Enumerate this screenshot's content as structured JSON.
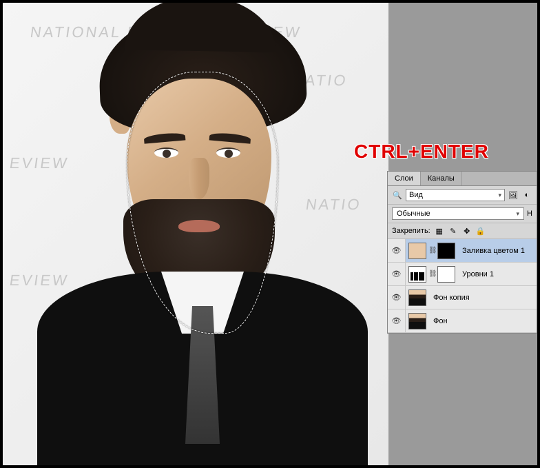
{
  "canvas": {
    "bg_text": "NATIONAL BOARD OF REVIEW",
    "bg_text_short1": "EVIEW",
    "bg_text_short2": "NATIO"
  },
  "hint": {
    "shortcut": "CTRL+ENTER"
  },
  "panel": {
    "tabs": {
      "layers": "Слои",
      "channels": "Каналы"
    },
    "kind_label": "Вид",
    "blend_mode": "Обычные",
    "opacity_label": "Н",
    "lock_label": "Закрепить:",
    "layers": [
      {
        "name": "Заливка цветом 1"
      },
      {
        "name": "Уровни 1"
      },
      {
        "name": "Фон копия"
      },
      {
        "name": "Фон"
      }
    ]
  }
}
